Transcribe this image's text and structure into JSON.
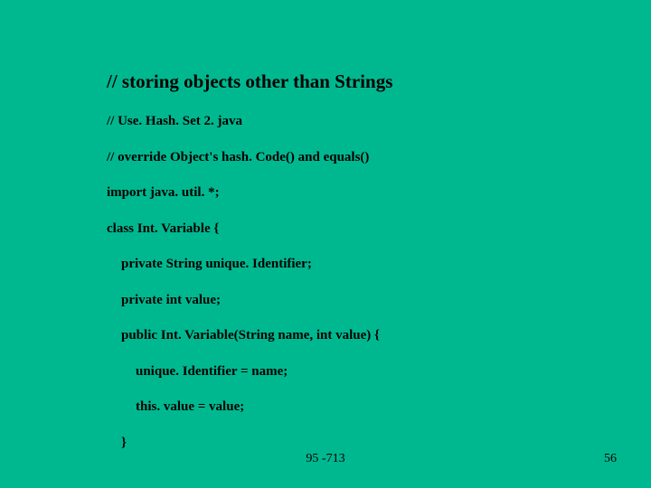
{
  "title": "// storing objects other than Strings",
  "lines": [
    {
      "text": "//  Use. Hash. Set 2. java",
      "indent": 0
    },
    {
      "text": "// override Object's hash. Code() and equals()",
      "indent": 0
    },
    {
      "text": "import java. util. *;",
      "indent": 0
    },
    {
      "text": "class Int. Variable {",
      "indent": 0
    },
    {
      "text": "private String unique. Identifier;",
      "indent": 1
    },
    {
      "text": "private int value;",
      "indent": 1
    },
    {
      "text": "public Int. Variable(String name, int value) {",
      "indent": 1
    },
    {
      "text": "unique. Identifier = name;",
      "indent": 2
    },
    {
      "text": "this. value = value;",
      "indent": 2
    },
    {
      "text": "}",
      "indent": 1
    }
  ],
  "footer_center": "95 -713",
  "footer_right": "56"
}
